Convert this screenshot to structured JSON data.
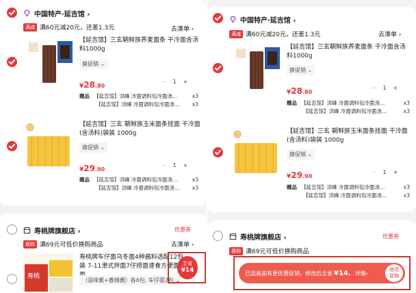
{
  "left": {
    "shop1": {
      "name": "中国特产·延吉馆 ›",
      "promo_tag": "满减",
      "promo_text": "满60元减20元，还差1.3元",
      "go_link": "去凑单 ›"
    },
    "item1": {
      "title": "【延吉馆】三玄朝鲜族荞麦面条 干冷面含汤料1000g",
      "spec": "换促销 ⌄",
      "price_symbol": "¥",
      "price_int": "28",
      "price_dec": ".80",
      "qty": "1",
      "gift_label": "赠品",
      "gift_1": "【延吉馆】洪峰 冷面调料包冷面汤…",
      "gift_2": "【延吉馆】洪峰 冷面调料包冷面汤…",
      "gift_1_qty": "x3",
      "gift_2_qty": "x3"
    },
    "item2": {
      "title": "【延吉馆】三玄 朝鲜族玉米面条挂面 干冷面(含汤料)袋装 1000g",
      "spec": "换促销 ⌄",
      "price_symbol": "¥",
      "price_int": "29",
      "price_dec": ".90",
      "qty": "1",
      "gift_label": "赠品",
      "gift_1": "【延吉馆】洪峰 冷面调料包冷面汤…",
      "gift_2": "【延吉馆】洪峰 冷面调料包冷面汤…",
      "gift_1_qty": "x3",
      "gift_2_qty": "x3"
    },
    "shop2": {
      "name": "寿桃牌旗舰店 ›",
      "coupon": "优惠券",
      "promo_tag": "换购",
      "promo_text": "满69元可低价换购商品",
      "go_link": "去凑单 ›"
    },
    "item3": {
      "title": "寿桃牌车仔面乌冬面4种酱料选配12包装 7-11港式拌面7仔捞面速食方便面拌面",
      "spec": "（滋味酱+香辣酱）各6包, 车仔面2包 ⌄",
      "badge_top": "立省",
      "badge_amount": "¥14",
      "brand": "寿桃"
    }
  },
  "right": {
    "shop1": {
      "name": "中国特产·延吉馆 ›",
      "promo_tag": "满减",
      "promo_text": "满60元减20元，还差1.3元",
      "go_link": "去凑单 ›"
    },
    "item1": {
      "title": "【延吉馆】三玄朝鲜族荞麦面条 干冷面含汤料1000g",
      "spec": "换促销 ⌄",
      "price_symbol": "¥",
      "price_int": "28",
      "price_dec": ".80",
      "qty": "1",
      "gift_label": "赠品",
      "gift_1": "【延吉馆】洪峰 冷面调料包冷面汤…",
      "gift_2": "【延吉馆】洪峰 冷面调料包冷面汤…",
      "gift_1_qty": "x3",
      "gift_2_qty": "x3"
    },
    "item2": {
      "title": "【延吉馆】三玄 朝鲜族玉米面条挂面 干冷面(含汤料)袋装 1000g",
      "spec": "换促销 ⌄",
      "price_symbol": "¥",
      "price_int": "29",
      "price_dec": ".90",
      "qty": "1",
      "gift_label": "赠品",
      "gift_1": "【延吉馆】洪峰 冷面调料包冷面汤…",
      "gift_2": "【延吉馆】洪峰 冷面调料包冷面汤…",
      "gift_1_qty": "x3",
      "gift_2_qty": "x3"
    },
    "shop2": {
      "name": "寿桃牌旗舰店 ›",
      "coupon": "优惠券",
      "promo_tag": "换购",
      "promo_text": "满69元可低价换购商品"
    },
    "toast": {
      "prefix": "已选商品有更优惠促销，修改后立省",
      "amount": "¥14.",
      "detail": "详情›",
      "button_line1": "修改",
      "button_line2": "促销"
    }
  },
  "colors": {
    "accent": "#e4393c",
    "highlight_box": "#c0392b"
  }
}
